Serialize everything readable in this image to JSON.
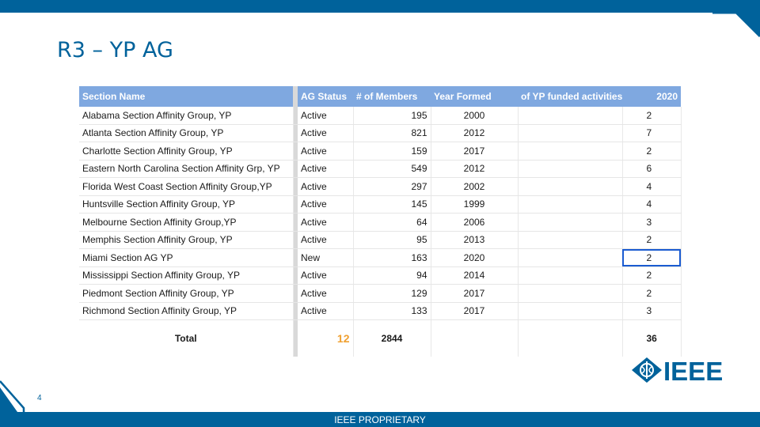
{
  "slide": {
    "title": "R3 – YP AG",
    "page_number": "4",
    "footer": "IEEE PROPRIETARY",
    "logo_text": "IEEE"
  },
  "table": {
    "columns": [
      "Section Name",
      "AG Status",
      "# of Members",
      "Year Formed",
      "of YP funded activities",
      "2020"
    ],
    "rows": [
      {
        "name": "Alabama Section Affinity Group, YP",
        "status": "Active",
        "members": "195",
        "year": "2000",
        "activities": "",
        "y2020": "2"
      },
      {
        "name": "Atlanta Section Affinity Group, YP",
        "status": "Active",
        "members": "821",
        "year": "2012",
        "activities": "",
        "y2020": "7"
      },
      {
        "name": "Charlotte Section Affinity Group, YP",
        "status": "Active",
        "members": "159",
        "year": "2017",
        "activities": "",
        "y2020": "2"
      },
      {
        "name": "Eastern North Carolina Section Affinity Grp, YP",
        "status": "Active",
        "members": "549",
        "year": "2012",
        "activities": "",
        "y2020": "6"
      },
      {
        "name": "Florida West Coast Section Affinity Group,YP",
        "status": "Active",
        "members": "297",
        "year": "2002",
        "activities": "",
        "y2020": "4"
      },
      {
        "name": "Huntsville Section Affinity Group, YP",
        "status": "Active",
        "members": "145",
        "year": "1999",
        "activities": "",
        "y2020": "4"
      },
      {
        "name": "Melbourne Section Affinity Group,YP",
        "status": "Active",
        "members": "64",
        "year": "2006",
        "activities": "",
        "y2020": "3"
      },
      {
        "name": "Memphis Section Affinity Group, YP",
        "status": "Active",
        "members": "95",
        "year": "2013",
        "activities": "",
        "y2020": "2"
      },
      {
        "name": "Miami Section AG YP",
        "status": "New",
        "members": "163",
        "year": "2020",
        "activities": "",
        "y2020": "2"
      },
      {
        "name": "Mississippi Section Affinity Group, YP",
        "status": "Active",
        "members": "94",
        "year": "2014",
        "activities": "",
        "y2020": "2"
      },
      {
        "name": "Piedmont Section Affinity Group, YP",
        "status": "Active",
        "members": "129",
        "year": "2017",
        "activities": "",
        "y2020": "2"
      },
      {
        "name": "Richmond Section Affinity Group, YP",
        "status": "Active",
        "members": "133",
        "year": "2017",
        "activities": "",
        "y2020": "3"
      }
    ],
    "total": {
      "label": "Total",
      "status_count": "12",
      "members": "2844",
      "y2020": "36"
    }
  },
  "colors": {
    "brand": "#00629b",
    "header": "#7fa8e0",
    "selection": "#1a5bd1"
  }
}
